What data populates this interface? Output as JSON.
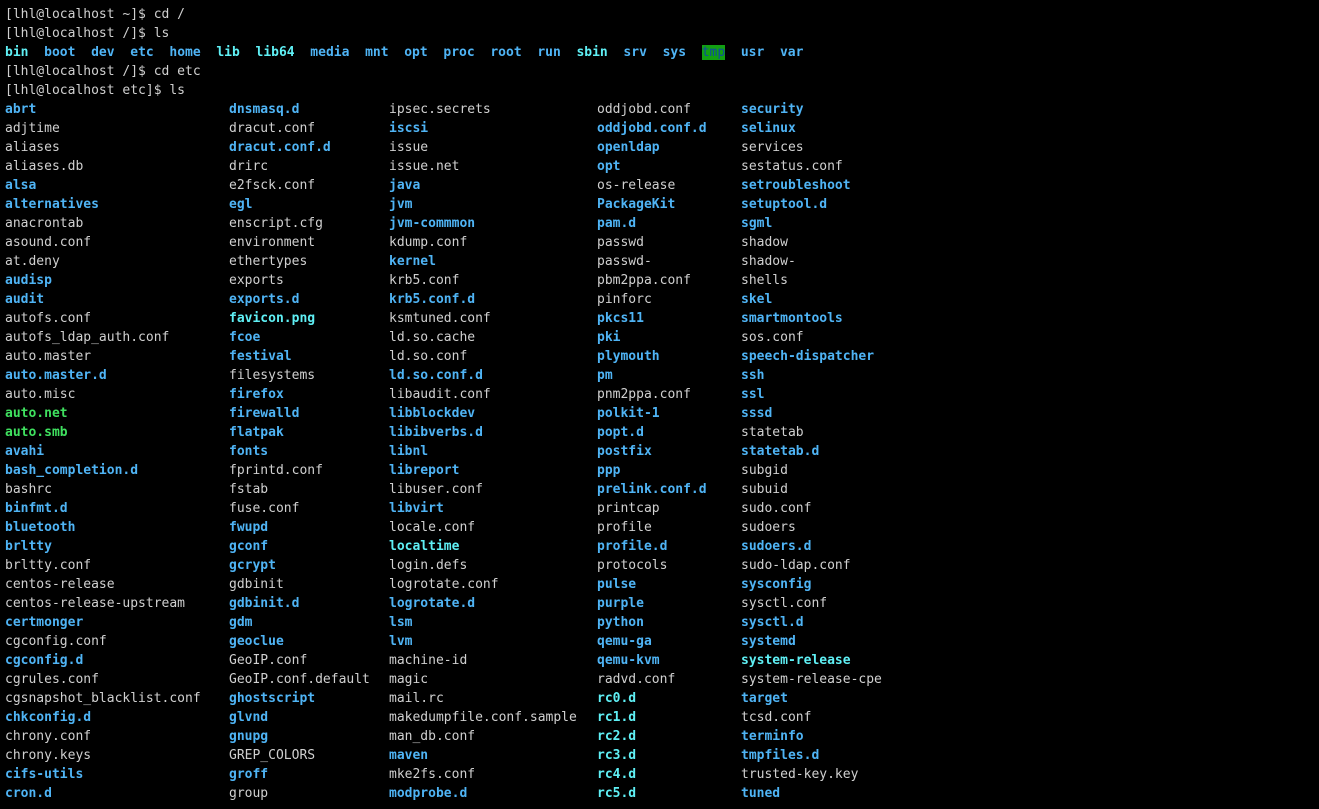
{
  "terminal": {
    "colors": {
      "background": "#000000",
      "text": "#d0d0d0",
      "directory": "#4fb4f5",
      "executable": "#3fe05f",
      "symlink": "#5ff0f5",
      "sticky_dir_bg": "#12a012",
      "sticky_dir_fg": "#104aa0"
    },
    "cmd_lines": [
      "[lhl@localhost ~]$ cd /",
      "[lhl@localhost /]$ ls",
      "[lhl@localhost /]$ cd etc",
      "[lhl@localhost etc]$ ls"
    ],
    "root_ls": [
      {
        "name": "bin",
        "type": "link"
      },
      {
        "name": "boot",
        "type": "dir"
      },
      {
        "name": "dev",
        "type": "dir"
      },
      {
        "name": "etc",
        "type": "dir"
      },
      {
        "name": "home",
        "type": "dir"
      },
      {
        "name": "lib",
        "type": "link"
      },
      {
        "name": "lib64",
        "type": "link"
      },
      {
        "name": "media",
        "type": "dir"
      },
      {
        "name": "mnt",
        "type": "dir"
      },
      {
        "name": "opt",
        "type": "dir"
      },
      {
        "name": "proc",
        "type": "dir"
      },
      {
        "name": "root",
        "type": "dir"
      },
      {
        "name": "run",
        "type": "dir"
      },
      {
        "name": "sbin",
        "type": "link"
      },
      {
        "name": "srv",
        "type": "dir"
      },
      {
        "name": "sys",
        "type": "dir"
      },
      {
        "name": "tmp",
        "type": "hl"
      },
      {
        "name": "usr",
        "type": "dir"
      },
      {
        "name": "var",
        "type": "dir"
      }
    ],
    "etc_ls": [
      [
        {
          "name": "abrt",
          "type": "dir"
        },
        {
          "name": "adjtime",
          "type": "file"
        },
        {
          "name": "aliases",
          "type": "file"
        },
        {
          "name": "aliases.db",
          "type": "file"
        },
        {
          "name": "alsa",
          "type": "dir"
        },
        {
          "name": "alternatives",
          "type": "dir"
        },
        {
          "name": "anacrontab",
          "type": "file"
        },
        {
          "name": "asound.conf",
          "type": "file"
        },
        {
          "name": "at.deny",
          "type": "file"
        },
        {
          "name": "audisp",
          "type": "dir"
        },
        {
          "name": "audit",
          "type": "dir"
        },
        {
          "name": "autofs.conf",
          "type": "file"
        },
        {
          "name": "autofs_ldap_auth.conf",
          "type": "file"
        },
        {
          "name": "auto.master",
          "type": "file"
        },
        {
          "name": "auto.master.d",
          "type": "dir"
        },
        {
          "name": "auto.misc",
          "type": "file"
        },
        {
          "name": "auto.net",
          "type": "exe"
        },
        {
          "name": "auto.smb",
          "type": "exe"
        },
        {
          "name": "avahi",
          "type": "dir"
        },
        {
          "name": "bash_completion.d",
          "type": "dir"
        },
        {
          "name": "bashrc",
          "type": "file"
        },
        {
          "name": "binfmt.d",
          "type": "dir"
        },
        {
          "name": "bluetooth",
          "type": "dir"
        },
        {
          "name": "brltty",
          "type": "dir"
        },
        {
          "name": "brltty.conf",
          "type": "file"
        },
        {
          "name": "centos-release",
          "type": "file"
        },
        {
          "name": "centos-release-upstream",
          "type": "file"
        },
        {
          "name": "certmonger",
          "type": "dir"
        },
        {
          "name": "cgconfig.conf",
          "type": "file"
        },
        {
          "name": "cgconfig.d",
          "type": "dir"
        },
        {
          "name": "cgrules.conf",
          "type": "file"
        },
        {
          "name": "cgsnapshot_blacklist.conf",
          "type": "file"
        },
        {
          "name": "chkconfig.d",
          "type": "dir"
        },
        {
          "name": "chrony.conf",
          "type": "file"
        },
        {
          "name": "chrony.keys",
          "type": "file"
        },
        {
          "name": "cifs-utils",
          "type": "dir"
        },
        {
          "name": "cron.d",
          "type": "dir"
        }
      ],
      [
        {
          "name": "dnsmasq.d",
          "type": "dir"
        },
        {
          "name": "dracut.conf",
          "type": "file"
        },
        {
          "name": "dracut.conf.d",
          "type": "dir"
        },
        {
          "name": "drirc",
          "type": "file"
        },
        {
          "name": "e2fsck.conf",
          "type": "file"
        },
        {
          "name": "egl",
          "type": "dir"
        },
        {
          "name": "enscript.cfg",
          "type": "file"
        },
        {
          "name": "environment",
          "type": "file"
        },
        {
          "name": "ethertypes",
          "type": "file"
        },
        {
          "name": "exports",
          "type": "file"
        },
        {
          "name": "exports.d",
          "type": "dir"
        },
        {
          "name": "favicon.png",
          "type": "link"
        },
        {
          "name": "fcoe",
          "type": "dir"
        },
        {
          "name": "festival",
          "type": "dir"
        },
        {
          "name": "filesystems",
          "type": "file"
        },
        {
          "name": "firefox",
          "type": "dir"
        },
        {
          "name": "firewalld",
          "type": "dir"
        },
        {
          "name": "flatpak",
          "type": "dir"
        },
        {
          "name": "fonts",
          "type": "dir"
        },
        {
          "name": "fprintd.conf",
          "type": "file"
        },
        {
          "name": "fstab",
          "type": "file"
        },
        {
          "name": "fuse.conf",
          "type": "file"
        },
        {
          "name": "fwupd",
          "type": "dir"
        },
        {
          "name": "gconf",
          "type": "dir"
        },
        {
          "name": "gcrypt",
          "type": "dir"
        },
        {
          "name": "gdbinit",
          "type": "file"
        },
        {
          "name": "gdbinit.d",
          "type": "dir"
        },
        {
          "name": "gdm",
          "type": "dir"
        },
        {
          "name": "geoclue",
          "type": "dir"
        },
        {
          "name": "GeoIP.conf",
          "type": "file"
        },
        {
          "name": "GeoIP.conf.default",
          "type": "file"
        },
        {
          "name": "ghostscript",
          "type": "dir"
        },
        {
          "name": "glvnd",
          "type": "dir"
        },
        {
          "name": "gnupg",
          "type": "dir"
        },
        {
          "name": "GREP_COLORS",
          "type": "file"
        },
        {
          "name": "groff",
          "type": "dir"
        },
        {
          "name": "group",
          "type": "file"
        }
      ],
      [
        {
          "name": "ipsec.secrets",
          "type": "file"
        },
        {
          "name": "iscsi",
          "type": "dir"
        },
        {
          "name": "issue",
          "type": "file"
        },
        {
          "name": "issue.net",
          "type": "file"
        },
        {
          "name": "java",
          "type": "dir"
        },
        {
          "name": "jvm",
          "type": "dir"
        },
        {
          "name": "jvm-commmon",
          "type": "dir"
        },
        {
          "name": "kdump.conf",
          "type": "file"
        },
        {
          "name": "kernel",
          "type": "dir"
        },
        {
          "name": "krb5.conf",
          "type": "file"
        },
        {
          "name": "krb5.conf.d",
          "type": "dir"
        },
        {
          "name": "ksmtuned.conf",
          "type": "file"
        },
        {
          "name": "ld.so.cache",
          "type": "file"
        },
        {
          "name": "ld.so.conf",
          "type": "file"
        },
        {
          "name": "ld.so.conf.d",
          "type": "dir"
        },
        {
          "name": "libaudit.conf",
          "type": "file"
        },
        {
          "name": "libblockdev",
          "type": "dir"
        },
        {
          "name": "libibverbs.d",
          "type": "dir"
        },
        {
          "name": "libnl",
          "type": "dir"
        },
        {
          "name": "libreport",
          "type": "dir"
        },
        {
          "name": "libuser.conf",
          "type": "file"
        },
        {
          "name": "libvirt",
          "type": "dir"
        },
        {
          "name": "locale.conf",
          "type": "file"
        },
        {
          "name": "localtime",
          "type": "link"
        },
        {
          "name": "login.defs",
          "type": "file"
        },
        {
          "name": "logrotate.conf",
          "type": "file"
        },
        {
          "name": "logrotate.d",
          "type": "dir"
        },
        {
          "name": "lsm",
          "type": "dir"
        },
        {
          "name": "lvm",
          "type": "dir"
        },
        {
          "name": "machine-id",
          "type": "file"
        },
        {
          "name": "magic",
          "type": "file"
        },
        {
          "name": "mail.rc",
          "type": "file"
        },
        {
          "name": "makedumpfile.conf.sample",
          "type": "file"
        },
        {
          "name": "man_db.conf",
          "type": "file"
        },
        {
          "name": "maven",
          "type": "dir"
        },
        {
          "name": "mke2fs.conf",
          "type": "file"
        },
        {
          "name": "modprobe.d",
          "type": "dir"
        }
      ],
      [
        {
          "name": "oddjobd.conf",
          "type": "file"
        },
        {
          "name": "oddjobd.conf.d",
          "type": "dir"
        },
        {
          "name": "openldap",
          "type": "dir"
        },
        {
          "name": "opt",
          "type": "dir"
        },
        {
          "name": "os-release",
          "type": "file"
        },
        {
          "name": "PackageKit",
          "type": "dir"
        },
        {
          "name": "pam.d",
          "type": "dir"
        },
        {
          "name": "passwd",
          "type": "file"
        },
        {
          "name": "passwd-",
          "type": "file"
        },
        {
          "name": "pbm2ppa.conf",
          "type": "file"
        },
        {
          "name": "pinforc",
          "type": "file"
        },
        {
          "name": "pkcs11",
          "type": "dir"
        },
        {
          "name": "pki",
          "type": "dir"
        },
        {
          "name": "plymouth",
          "type": "dir"
        },
        {
          "name": "pm",
          "type": "dir"
        },
        {
          "name": "pnm2ppa.conf",
          "type": "file"
        },
        {
          "name": "polkit-1",
          "type": "dir"
        },
        {
          "name": "popt.d",
          "type": "dir"
        },
        {
          "name": "postfix",
          "type": "dir"
        },
        {
          "name": "ppp",
          "type": "dir"
        },
        {
          "name": "prelink.conf.d",
          "type": "dir"
        },
        {
          "name": "printcap",
          "type": "file"
        },
        {
          "name": "profile",
          "type": "file"
        },
        {
          "name": "profile.d",
          "type": "dir"
        },
        {
          "name": "protocols",
          "type": "file"
        },
        {
          "name": "pulse",
          "type": "dir"
        },
        {
          "name": "purple",
          "type": "dir"
        },
        {
          "name": "python",
          "type": "dir"
        },
        {
          "name": "qemu-ga",
          "type": "dir"
        },
        {
          "name": "qemu-kvm",
          "type": "dir"
        },
        {
          "name": "radvd.conf",
          "type": "file"
        },
        {
          "name": "rc0.d",
          "type": "link"
        },
        {
          "name": "rc1.d",
          "type": "link"
        },
        {
          "name": "rc2.d",
          "type": "link"
        },
        {
          "name": "rc3.d",
          "type": "link"
        },
        {
          "name": "rc4.d",
          "type": "link"
        },
        {
          "name": "rc5.d",
          "type": "link"
        }
      ],
      [
        {
          "name": "security",
          "type": "dir"
        },
        {
          "name": "selinux",
          "type": "dir"
        },
        {
          "name": "services",
          "type": "file"
        },
        {
          "name": "sestatus.conf",
          "type": "file"
        },
        {
          "name": "setroubleshoot",
          "type": "dir"
        },
        {
          "name": "setuptool.d",
          "type": "dir"
        },
        {
          "name": "sgml",
          "type": "dir"
        },
        {
          "name": "shadow",
          "type": "file"
        },
        {
          "name": "shadow-",
          "type": "file"
        },
        {
          "name": "shells",
          "type": "file"
        },
        {
          "name": "skel",
          "type": "dir"
        },
        {
          "name": "smartmontools",
          "type": "dir"
        },
        {
          "name": "sos.conf",
          "type": "file"
        },
        {
          "name": "speech-dispatcher",
          "type": "dir"
        },
        {
          "name": "ssh",
          "type": "dir"
        },
        {
          "name": "ssl",
          "type": "dir"
        },
        {
          "name": "sssd",
          "type": "dir"
        },
        {
          "name": "statetab",
          "type": "file"
        },
        {
          "name": "statetab.d",
          "type": "dir"
        },
        {
          "name": "subgid",
          "type": "file"
        },
        {
          "name": "subuid",
          "type": "file"
        },
        {
          "name": "sudo.conf",
          "type": "file"
        },
        {
          "name": "sudoers",
          "type": "file"
        },
        {
          "name": "sudoers.d",
          "type": "dir"
        },
        {
          "name": "sudo-ldap.conf",
          "type": "file"
        },
        {
          "name": "sysconfig",
          "type": "dir"
        },
        {
          "name": "sysctl.conf",
          "type": "file"
        },
        {
          "name": "sysctl.d",
          "type": "dir"
        },
        {
          "name": "systemd",
          "type": "dir"
        },
        {
          "name": "system-release",
          "type": "link"
        },
        {
          "name": "system-release-cpe",
          "type": "file"
        },
        {
          "name": "target",
          "type": "dir"
        },
        {
          "name": "tcsd.conf",
          "type": "file"
        },
        {
          "name": "terminfo",
          "type": "dir"
        },
        {
          "name": "tmpfiles.d",
          "type": "dir"
        },
        {
          "name": "trusted-key.key",
          "type": "file"
        },
        {
          "name": "tuned",
          "type": "dir"
        }
      ]
    ]
  }
}
